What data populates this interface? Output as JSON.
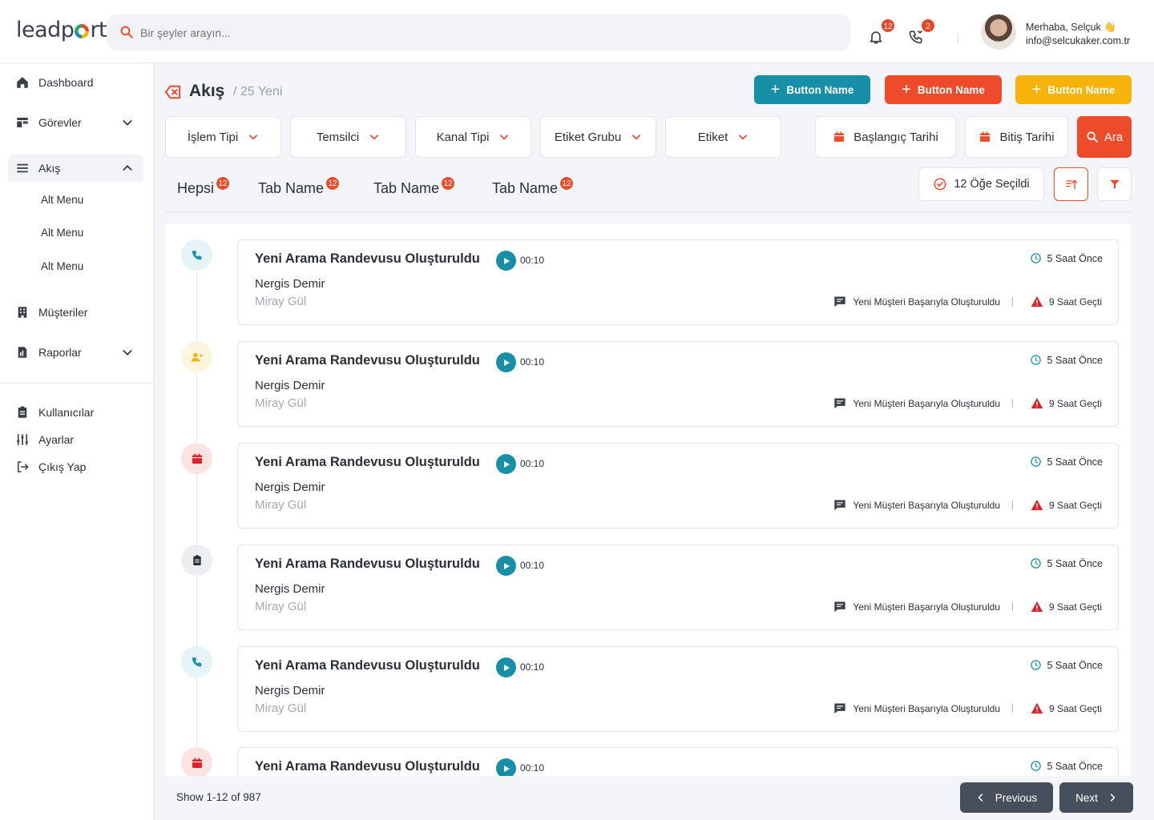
{
  "app": {
    "logo": "leadport"
  },
  "search": {
    "placeholder": "Bir şeyler arayın..."
  },
  "notifications": {
    "bell_count": "12",
    "call_count": "2"
  },
  "user": {
    "greeting": "Merhaba, Selçuk 👋",
    "email": "info@selcukaker.com.tr"
  },
  "sidebar": {
    "items": [
      {
        "label": "Dashboard"
      },
      {
        "label": "Görevler"
      },
      {
        "label": "Akış"
      },
      {
        "label": "Müşteriler"
      },
      {
        "label": "Raporlar"
      }
    ],
    "sub_items": [
      {
        "label": "Alt Menu"
      },
      {
        "label": "Alt Menu"
      },
      {
        "label": "Alt Menu"
      }
    ],
    "bottom_items": [
      {
        "label": "Kullanıcılar"
      },
      {
        "label": "Ayarlar"
      },
      {
        "label": "Çıkış Yap"
      }
    ]
  },
  "header": {
    "title": "Akış",
    "subtitle": "/ 25 Yeni",
    "buttons": [
      {
        "label": "Button Name"
      },
      {
        "label": "Button Name"
      },
      {
        "label": "Button Name"
      }
    ]
  },
  "filters": {
    "dropdowns": [
      {
        "label": "İşlem Tipi"
      },
      {
        "label": "Temsilci"
      },
      {
        "label": "Kanal Tipi"
      },
      {
        "label": "Etiket Grubu"
      },
      {
        "label": "Etiket"
      }
    ],
    "start_date": "Başlangıç Tarihi",
    "end_date": "Bitiş Tarihi",
    "search_label": "Ara"
  },
  "tabs": [
    {
      "label": "Hepsi",
      "count": "12"
    },
    {
      "label": "Tab Name",
      "count": "12"
    },
    {
      "label": "Tab Name",
      "count": "12"
    },
    {
      "label": "Tab Name",
      "count": "12"
    }
  ],
  "selection": {
    "label": "12 Öğe Seçildi"
  },
  "feed": [
    {
      "icon": "phone-icon",
      "title": "Yeni Arama Randevusu Oluşturuldu",
      "duration": "00:10",
      "person": "Nergis Demir",
      "agent": "Miray Gül",
      "time_ago": "5 Saat Önce",
      "message": "Yeni Müşteri Başarıyla Oluşturuldu",
      "overdue": "9 Saat Geçti"
    },
    {
      "icon": "user-add-icon",
      "title": "Yeni Arama Randevusu Oluşturuldu",
      "duration": "00:10",
      "person": "Nergis Demir",
      "agent": "Miray Gül",
      "time_ago": "5 Saat Önce",
      "message": "Yeni Müşteri Başarıyla Oluşturuldu",
      "overdue": "9 Saat Geçti"
    },
    {
      "icon": "calendar-icon",
      "title": "Yeni Arama Randevusu Oluşturuldu",
      "duration": "00:10",
      "person": "Nergis Demir",
      "agent": "Miray Gül",
      "time_ago": "5 Saat Önce",
      "message": "Yeni Müşteri Başarıyla Oluşturuldu",
      "overdue": "9 Saat Geçti"
    },
    {
      "icon": "clipboard-icon",
      "title": "Yeni Arama Randevusu Oluşturuldu",
      "duration": "00:10",
      "person": "Nergis Demir",
      "agent": "Miray Gül",
      "time_ago": "5 Saat Önce",
      "message": "Yeni Müşteri Başarıyla Oluşturuldu",
      "overdue": "9 Saat Geçti"
    },
    {
      "icon": "phone-icon",
      "title": "Yeni Arama Randevusu Oluşturuldu",
      "duration": "00:10",
      "person": "Nergis Demir",
      "agent": "Miray Gül",
      "time_ago": "5 Saat Önce",
      "message": "Yeni Müşteri Başarıyla Oluşturuldu",
      "overdue": "9 Saat Geçti"
    },
    {
      "icon": "calendar-icon",
      "title": "Yeni Arama Randevusu Oluşturuldu",
      "duration": "00:10",
      "time_ago": "5 Saat Önce"
    }
  ],
  "pagination": {
    "summary": "Show 1-12 of 987",
    "prev": "Previous",
    "next": "Next"
  },
  "colors": {
    "teal": "#168fa7",
    "red": "#ee4b2b",
    "yellow": "#f8b30a"
  }
}
